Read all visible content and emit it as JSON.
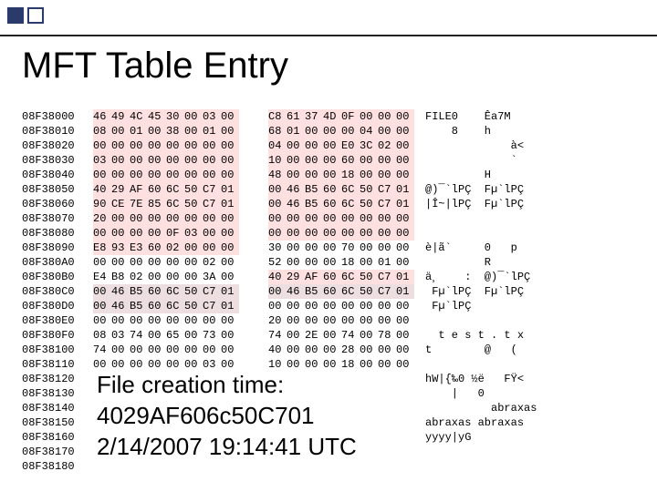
{
  "title": "MFT Table Entry",
  "overlay": {
    "line1": "File creation time:",
    "line2": "4029AF606c50C701",
    "line3": "2/14/2007 19:14:41 UTC"
  },
  "hex": {
    "rows": [
      {
        "addr": "08F38000",
        "b": [
          "46",
          "49",
          "4C",
          "45",
          "30",
          "00",
          "03",
          "00",
          "",
          "C8",
          "61",
          "37",
          "4D",
          "0F",
          "00",
          "00",
          "00"
        ],
        "a": "FILE0    Êa7M",
        "hl": [
          0,
          1,
          2,
          3,
          4,
          5,
          6,
          7,
          9,
          10,
          11,
          12,
          13,
          14,
          15,
          16
        ]
      },
      {
        "addr": "08F38010",
        "b": [
          "08",
          "00",
          "01",
          "00",
          "38",
          "00",
          "01",
          "00",
          "",
          "68",
          "01",
          "00",
          "00",
          "00",
          "04",
          "00",
          "00"
        ],
        "a": "    8    h",
        "hl": [
          0,
          1,
          2,
          3,
          4,
          5,
          6,
          7,
          9,
          10,
          11,
          12,
          13,
          14,
          15,
          16
        ]
      },
      {
        "addr": "08F38020",
        "b": [
          "00",
          "00",
          "00",
          "00",
          "00",
          "00",
          "00",
          "00",
          "",
          "04",
          "00",
          "00",
          "00",
          "E0",
          "3C",
          "02",
          "00"
        ],
        "a": "             à<",
        "hl": [
          0,
          1,
          2,
          3,
          4,
          5,
          6,
          7,
          9,
          10,
          11,
          12,
          13,
          14,
          15,
          16
        ]
      },
      {
        "addr": "08F38030",
        "b": [
          "03",
          "00",
          "00",
          "00",
          "00",
          "00",
          "00",
          "00",
          "",
          "10",
          "00",
          "00",
          "00",
          "60",
          "00",
          "00",
          "00"
        ],
        "a": "             `",
        "hl": [
          0,
          1,
          2,
          3,
          4,
          5,
          6,
          7,
          9,
          10,
          11,
          12,
          13,
          14,
          15,
          16
        ]
      },
      {
        "addr": "08F38040",
        "b": [
          "00",
          "00",
          "00",
          "00",
          "00",
          "00",
          "00",
          "00",
          "",
          "48",
          "00",
          "00",
          "00",
          "18",
          "00",
          "00",
          "00"
        ],
        "a": "         H",
        "hl": [
          0,
          1,
          2,
          3,
          4,
          5,
          6,
          7,
          9,
          10,
          11,
          12,
          13,
          14,
          15,
          16
        ]
      },
      {
        "addr": "08F38050",
        "b": [
          "40",
          "29",
          "AF",
          "60",
          "6C",
          "50",
          "C7",
          "01",
          "",
          "00",
          "46",
          "B5",
          "60",
          "6C",
          "50",
          "C7",
          "01"
        ],
        "a": "@)¯`lPÇ  Fµ`lPÇ",
        "hl": [
          0,
          1,
          2,
          3,
          4,
          5,
          6,
          7,
          9,
          10,
          11,
          12,
          13,
          14,
          15,
          16
        ]
      },
      {
        "addr": "08F38060",
        "b": [
          "90",
          "CE",
          "7E",
          "85",
          "6C",
          "50",
          "C7",
          "01",
          "",
          "00",
          "46",
          "B5",
          "60",
          "6C",
          "50",
          "C7",
          "01"
        ],
        "a": "|Î~|lPÇ  Fµ`lPÇ",
        "hl": [
          0,
          1,
          2,
          3,
          4,
          5,
          6,
          7,
          9,
          10,
          11,
          12,
          13,
          14,
          15,
          16
        ]
      },
      {
        "addr": "08F38070",
        "b": [
          "20",
          "00",
          "00",
          "00",
          "00",
          "00",
          "00",
          "00",
          "",
          "00",
          "00",
          "00",
          "00",
          "00",
          "00",
          "00",
          "00"
        ],
        "a": "",
        "hl": [
          0,
          1,
          2,
          3,
          4,
          5,
          6,
          7,
          9,
          10,
          11,
          12,
          13,
          14,
          15,
          16
        ]
      },
      {
        "addr": "08F38080",
        "b": [
          "00",
          "00",
          "00",
          "00",
          "0F",
          "03",
          "00",
          "00",
          "",
          "00",
          "00",
          "00",
          "00",
          "00",
          "00",
          "00",
          "00"
        ],
        "a": "",
        "hl": [
          0,
          1,
          2,
          3,
          4,
          5,
          6,
          7,
          9,
          10,
          11,
          12,
          13,
          14,
          15,
          16
        ]
      },
      {
        "addr": "08F38090",
        "b": [
          "E8",
          "93",
          "E3",
          "60",
          "02",
          "00",
          "00",
          "00",
          "",
          "30",
          "00",
          "00",
          "00",
          "70",
          "00",
          "00",
          "00"
        ],
        "a": "è|ã`     0   p",
        "hl": [
          0,
          1,
          2,
          3,
          4,
          5,
          6,
          7
        ]
      },
      {
        "addr": "08F380A0",
        "b": [
          "00",
          "00",
          "00",
          "00",
          "00",
          "00",
          "02",
          "00",
          "",
          "52",
          "00",
          "00",
          "00",
          "18",
          "00",
          "01",
          "00"
        ],
        "a": "         R",
        "hl": []
      },
      {
        "addr": "08F380B0",
        "b": [
          "E4",
          "B8",
          "02",
          "00",
          "00",
          "00",
          "3A",
          "00",
          "",
          "40",
          "29",
          "AF",
          "60",
          "6C",
          "50",
          "C7",
          "01"
        ],
        "a": "ä¸    :  @)¯`lPÇ",
        "hl": [
          9,
          10,
          11,
          12,
          13,
          14,
          15,
          16
        ]
      },
      {
        "addr": "08F380C0",
        "b": [
          "00",
          "46",
          "B5",
          "60",
          "6C",
          "50",
          "C7",
          "01",
          "",
          "00",
          "46",
          "B5",
          "60",
          "6C",
          "50",
          "C7",
          "01"
        ],
        "a": " Fµ`lPÇ  Fµ`lPÇ",
        "hl": [
          0,
          1,
          2,
          3,
          4,
          5,
          6,
          7,
          9,
          10,
          11,
          12,
          13,
          14,
          15,
          16
        ],
        "hlClass": "hl2"
      },
      {
        "addr": "08F380D0",
        "b": [
          "00",
          "46",
          "B5",
          "60",
          "6C",
          "50",
          "C7",
          "01",
          "",
          "00",
          "00",
          "00",
          "00",
          "00",
          "00",
          "00",
          "00"
        ],
        "a": " Fµ`lPÇ",
        "hl": [
          0,
          1,
          2,
          3,
          4,
          5,
          6,
          7
        ],
        "hlClass": "hl2"
      },
      {
        "addr": "08F380E0",
        "b": [
          "00",
          "00",
          "00",
          "00",
          "00",
          "00",
          "00",
          "00",
          "",
          "20",
          "00",
          "00",
          "00",
          "00",
          "00",
          "00",
          "00"
        ],
        "a": "",
        "hl": []
      },
      {
        "addr": "08F380F0",
        "b": [
          "08",
          "03",
          "74",
          "00",
          "65",
          "00",
          "73",
          "00",
          "",
          "74",
          "00",
          "2E",
          "00",
          "74",
          "00",
          "78",
          "00"
        ],
        "a": "  t e s t . t x",
        "hl": []
      },
      {
        "addr": "08F38100",
        "b": [
          "74",
          "00",
          "00",
          "00",
          "00",
          "00",
          "00",
          "00",
          "",
          "40",
          "00",
          "00",
          "00",
          "28",
          "00",
          "00",
          "00"
        ],
        "a": "t        @   (",
        "hl": []
      },
      {
        "addr": "08F38110",
        "b": [
          "00",
          "00",
          "00",
          "00",
          "00",
          "00",
          "03",
          "00",
          "",
          "10",
          "00",
          "00",
          "00",
          "18",
          "00",
          "00",
          "00"
        ],
        "a": "",
        "hl": []
      },
      {
        "addr": "08F38120",
        "b": [
          "",
          "",
          "",
          "",
          "",
          "",
          "",
          "",
          "",
          "",
          "",
          "",
          "",
          "",
          "",
          "",
          ""
        ],
        "a": "hW|{‰0 ½ë   FŸ<",
        "hl": []
      },
      {
        "addr": "08F38130",
        "b": [
          "",
          "",
          "",
          "",
          "",
          "",
          "",
          "",
          "",
          "",
          "",
          "",
          "",
          "",
          "",
          "",
          ""
        ],
        "a": "    |   0",
        "hl": []
      },
      {
        "addr": "08F38140",
        "b": [
          "",
          "",
          "",
          "",
          "",
          "",
          "",
          "",
          "",
          "",
          "",
          "",
          "",
          "",
          "",
          "",
          ""
        ],
        "a": "          abraxas",
        "hl": []
      },
      {
        "addr": "08F38150",
        "b": [
          "",
          "",
          "",
          "",
          "",
          "",
          "",
          "",
          "",
          "",
          "",
          "",
          "",
          "",
          "",
          "",
          ""
        ],
        "a": "abraxas abraxas",
        "hl": []
      },
      {
        "addr": "08F38160",
        "b": [
          "",
          "",
          "",
          "",
          "",
          "",
          "",
          "",
          "",
          "",
          "",
          "",
          "",
          "",
          "",
          "",
          ""
        ],
        "a": "yyyy|yG",
        "hl": []
      },
      {
        "addr": "08F38170",
        "b": [
          "",
          "",
          "",
          "",
          "",
          "",
          "",
          "",
          "",
          "",
          "",
          "",
          "",
          "",
          "",
          "",
          ""
        ],
        "a": "",
        "hl": []
      },
      {
        "addr": "08F38180",
        "b": [
          "",
          "",
          "",
          "",
          "",
          "",
          "",
          "",
          "",
          "",
          "",
          "",
          "",
          "",
          "",
          "",
          ""
        ],
        "a": "",
        "hl": []
      }
    ]
  }
}
